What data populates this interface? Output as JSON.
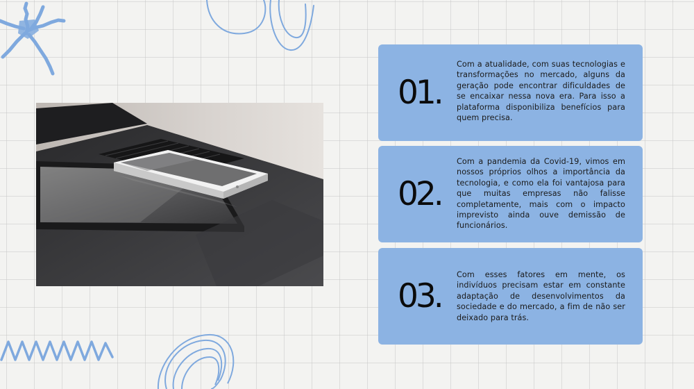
{
  "colors": {
    "card_bg": "#8cb3e3",
    "scribble": "#7fa9de",
    "background": "#f3f3f1"
  },
  "image": {
    "name": "laptop-phone-tablet-photo"
  },
  "items": [
    {
      "number": "01.",
      "text": "Com a atualidade, com suas tecnologias e transformações no mercado, alguns da geração pode encontrar dificuldades de se encaixar nessa nova era. Para isso a plataforma disponibiliza benefícios para quem precisa."
    },
    {
      "number": "02.",
      "text": "Com a pandemia da Covid-19, vimos em nossos próprios olhos a importância da tecnologia, e como ela foi vantajosa para que muitas empresas não falisse completamente, mais com o impacto imprevisto ainda ouve demissão de funcionários."
    },
    {
      "number": "03.",
      "text": "Com esses fatores em mente, os indivíduos precisam estar em constante adaptação de desenvolvimentos da sociedade e do mercado, a fim de não ser deixado para trás."
    }
  ]
}
